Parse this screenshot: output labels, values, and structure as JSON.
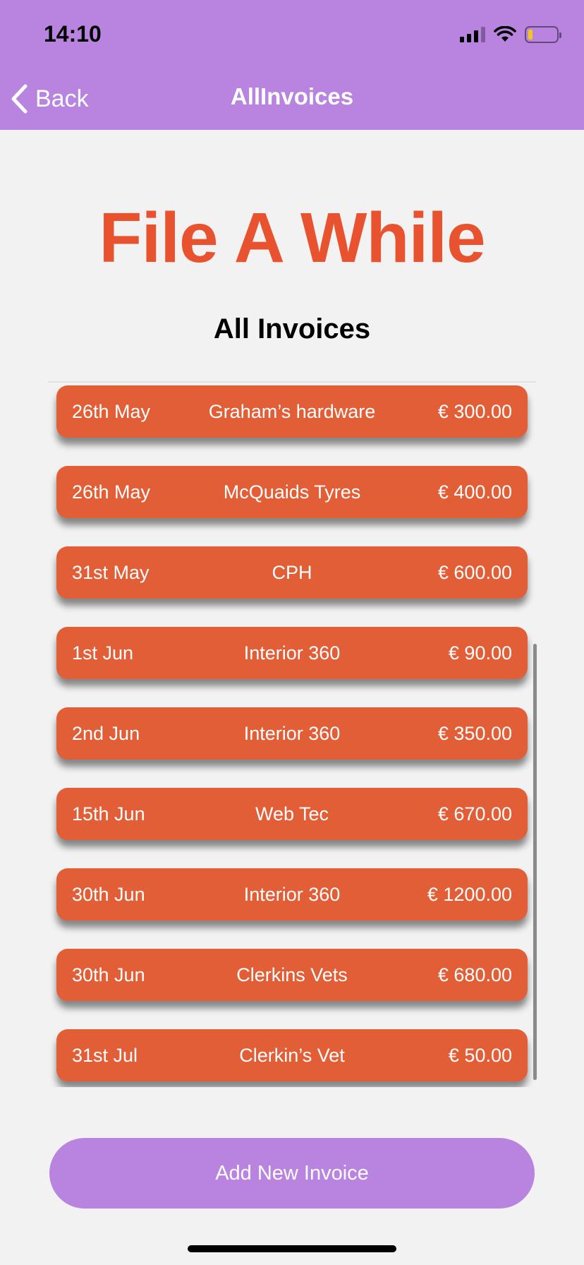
{
  "status_bar": {
    "time": "14:10",
    "icons": [
      "cellular-signal-icon",
      "wifi-icon",
      "battery-icon"
    ]
  },
  "nav": {
    "back_label": "Back",
    "title": "AllInvoices"
  },
  "brand": {
    "title": "File A While"
  },
  "section": {
    "title": "All Invoices"
  },
  "invoices": [
    {
      "date": "26th May",
      "vendor": "Graham’s hardware",
      "amount": "€ 300.00"
    },
    {
      "date": "26th May",
      "vendor": "McQuaids Tyres",
      "amount": "€ 400.00"
    },
    {
      "date": "31st May",
      "vendor": "CPH",
      "amount": "€ 600.00"
    },
    {
      "date": "1st Jun",
      "vendor": "Interior 360",
      "amount": "€ 90.00"
    },
    {
      "date": "2nd Jun",
      "vendor": "Interior 360",
      "amount": "€ 350.00"
    },
    {
      "date": "15th Jun",
      "vendor": "Web Tec",
      "amount": "€ 670.00"
    },
    {
      "date": "30th Jun",
      "vendor": "Interior 360",
      "amount": "€ 1200.00"
    },
    {
      "date": "30th Jun",
      "vendor": "Clerkins Vets",
      "amount": "€ 680.00"
    },
    {
      "date": "31st Jul",
      "vendor": "Clerkin’s Vet",
      "amount": "€ 50.00"
    }
  ],
  "actions": {
    "add_invoice_label": "Add New Invoice"
  },
  "colors": {
    "header": "#b884e0",
    "brand": "#e8522f",
    "row": "#e25e37",
    "background": "#f2f2f2"
  }
}
